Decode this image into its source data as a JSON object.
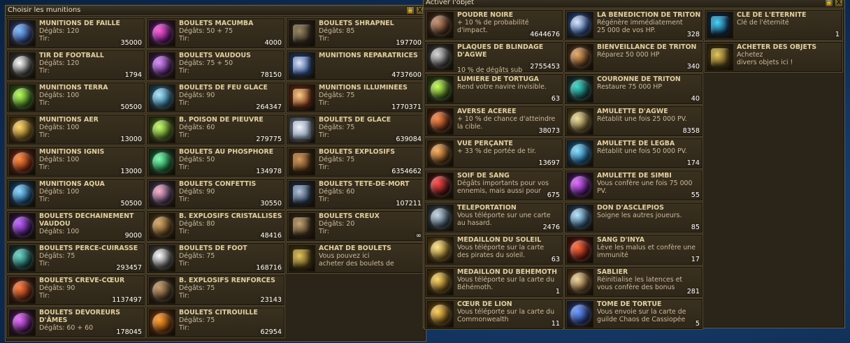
{
  "colors": {
    "accent": "#e2cfa0",
    "text": "#cdb99a",
    "panel": "#2b2418",
    "border": "#5a4c30",
    "sea": "#163a66"
  },
  "ammo_panel": {
    "title": "Choisir les munitions",
    "lock_label": "🔒",
    "close_label": "X",
    "items": [
      {
        "name": "MUNITIONS DE FAILLE",
        "l1": "Dégâts: 120",
        "l2": "Tir:",
        "count": "35000",
        "icon": "rift-ammo-icon",
        "c1": "#7ab8ff",
        "c2": "#23306a"
      },
      {
        "name": "BOULETS MACUMBA",
        "l1": "Dégâts: 50  + 75",
        "l2": "Tir:",
        "count": "4000",
        "icon": "macumba-cannonball-icon",
        "c1": "#ff5ad8",
        "c2": "#4a0a5a"
      },
      {
        "name": "BOULETS SHRAPNEL",
        "l1": "Dégâts: 85",
        "l2": "Tir:",
        "count": "197700",
        "icon": "shrapnel-cannonball-icon",
        "c1": "#9e8a66",
        "c2": "#2e261a"
      },
      {
        "name": "TIR DE FOOTBALL",
        "l1": "Dégâts: 120",
        "l2": "Tir:",
        "count": "1794",
        "icon": "football-shot-icon",
        "c1": "#ffffff",
        "c2": "#333333"
      },
      {
        "name": "BOULETS VAUDOUS",
        "l1": "Dégâts: 75  + 50",
        "l2": "Tir:",
        "count": "78150",
        "icon": "voodoo-cannonball-icon",
        "c1": "#d98cff",
        "c2": "#3a1250"
      },
      {
        "name": "MUNITIONS RÉPARATRICES",
        "l1": "",
        "l2": "",
        "count": "4737600",
        "icon": "repair-ammo-icon",
        "c1": "#dde8ff",
        "c2": "#24407a"
      },
      {
        "name": "MUNITIONS TERRA",
        "l1": "Dégâts: 100",
        "l2": "Tir:",
        "count": "50500",
        "icon": "terra-ammo-icon",
        "c1": "#b8ff5a",
        "c2": "#2a5a10"
      },
      {
        "name": "BOULETS DE FEU GLACÉ",
        "l1": "Dégâts: 90",
        "l2": "Tir:",
        "count": "264347",
        "icon": "frost-fire-cannonball-icon",
        "c1": "#a8e8ff",
        "c2": "#1a5070"
      },
      {
        "name": "MUNITIONS ILLUMINÉES",
        "l1": "Dégâts: 75",
        "l2": "Tir:",
        "count": "1770371",
        "icon": "illuminated-ammo-icon",
        "c1": "#ffd08a",
        "c2": "#6a2a10"
      },
      {
        "name": "MUNITIONS AER",
        "l1": "Dégâts: 100",
        "l2": "Tir:",
        "count": "13000",
        "icon": "aer-ammo-icon",
        "c1": "#ffd86a",
        "c2": "#6a4a10"
      },
      {
        "name": "B. POISON DE PIEUVRE",
        "l1": "Dégâts: 60",
        "l2": "Tir:",
        "count": "279775",
        "icon": "octopus-poison-icon",
        "c1": "#c8ff6a",
        "c2": "#3a5a10"
      },
      {
        "name": "BOULETS DE GLACE",
        "l1": "Dégâts: 75",
        "l2": "Tir:",
        "count": "639084",
        "icon": "ice-cannonball-icon",
        "c1": "#f2f6ff",
        "c2": "#7a8aa0"
      },
      {
        "name": "MUNITIONS IGNIS",
        "l1": "Dégâts: 100",
        "l2": "Tir:",
        "count": "13000",
        "icon": "ignis-ammo-icon",
        "c1": "#ff8a3a",
        "c2": "#6a1a08"
      },
      {
        "name": "BOULETS AU PHOSPHORE",
        "l1": "Dégâts: 50",
        "l2": "Tir:",
        "count": "134978",
        "icon": "phosphor-cannonball-icon",
        "c1": "#7affb0",
        "c2": "#0a5a2a"
      },
      {
        "name": "BOULETS EXPLOSIFS",
        "l1": "Dégâts: 75",
        "l2": "Tir:",
        "count": "6354662",
        "icon": "explosive-cannonball-icon",
        "c1": "#d8a060",
        "c2": "#4a2a10"
      },
      {
        "name": "MUNITIONS AQUA",
        "l1": "Dégâts: 100",
        "l2": "Tir:",
        "count": "50500",
        "icon": "aqua-ammo-icon",
        "c1": "#8ad8ff",
        "c2": "#0a3a6a"
      },
      {
        "name": "BOULETS CONFETTIS",
        "l1": "Dégâts: 90",
        "l2": "Tir:",
        "count": "30550",
        "icon": "confetti-cannonball-icon",
        "c1": "#ffb0d0",
        "c2": "#3a2a4a"
      },
      {
        "name": "BOULETS TÊTE-DE-MORT",
        "l1": "Dégâts: 60",
        "l2": "Tir:",
        "count": "107211",
        "icon": "skull-cannonball-icon",
        "c1": "#b8c8e0",
        "c2": "#20304a"
      },
      {
        "name": "BOULETS DÉCHAÎNEMENT VAUDOU",
        "l1": "Dégâts: 100",
        "l2": "",
        "count": "9000",
        "icon": "voodoo-frenzy-icon",
        "c1": "#c060ff",
        "c2": "#2a0a4a",
        "wrap": true
      },
      {
        "name": "B. EXPLOSIFS CRISTALLISÉS",
        "l1": "Dégâts: 80",
        "l2": "Tir:",
        "count": "48416",
        "icon": "crystal-explosive-icon",
        "c1": "#d8a868",
        "c2": "#4a3010"
      },
      {
        "name": "BOULETS CREUX",
        "l1": "Dégâts: 20",
        "l2": "Tir:",
        "count": "∞",
        "icon": "hollow-cannonball-icon",
        "c1": "#c8a878",
        "c2": "#3a2a18"
      },
      {
        "name": "BOULETS PERCE-CUIRASSE",
        "l1": "Dégâts: 75",
        "l2": "Tir:",
        "count": "293457",
        "icon": "armor-piercing-icon",
        "c1": "#6ad8c8",
        "c2": "#0a3a3a"
      },
      {
        "name": "BOULETS DE FOOT",
        "l1": "Dégâts: 75",
        "l2": "Tir:",
        "count": "168716",
        "icon": "soccer-cannonball-icon",
        "c1": "#ffffff",
        "c2": "#404040"
      },
      {
        "name": "ACHAT DE BOULETS",
        "l1": "Vous pouvez ici",
        "l2": "acheter des boulets de",
        "count": "",
        "icon": "buy-cannonballs-icon",
        "c1": "#e8c860",
        "c2": "#4a3a10"
      },
      {
        "name": "BOULETS CRÈVE-CŒUR",
        "l1": "Dégâts: 90",
        "l2": "Tir:",
        "count": "1137497",
        "icon": "heartbreaker-icon",
        "c1": "#ff7a3a",
        "c2": "#5a1a08"
      },
      {
        "name": "B. EXPLOSIFS RENFORCÉS",
        "l1": "Dégâts: 75",
        "l2": "Tir:",
        "count": "23143",
        "icon": "reinforced-explosive-icon",
        "c1": "#c89a6a",
        "c2": "#3a2a18"
      },
      {
        "name": "",
        "l1": "",
        "l2": "",
        "count": "",
        "icon": "",
        "c1": "",
        "c2": "",
        "empty": true
      },
      {
        "name": "BOULETS DÉVOREURS D'ÂMES",
        "l1": "Dégâts: 60  + 60",
        "l2": "",
        "count": "178045",
        "icon": "soul-devourer-icon",
        "c1": "#e86aff",
        "c2": "#3a0a4a",
        "wrap": true
      },
      {
        "name": "BOULETS CITROUILLE",
        "l1": "Dégâts: 75",
        "l2": "Tir:",
        "count": "62954",
        "icon": "pumpkin-cannonball-icon",
        "c1": "#ffa030",
        "c2": "#6a2a00"
      }
    ]
  },
  "items_panel": {
    "title": "Activer l'objet",
    "lock_label": "🔒",
    "close_label": "X",
    "items": [
      {
        "name": "POUDRE NOIRE",
        "l1": "+ 10 % de probabilité",
        "l2": "d'impact.",
        "count": "4644676",
        "icon": "black-powder-icon",
        "c1": "#c89070",
        "c2": "#3a2010"
      },
      {
        "name": "LA BÉNÉDICTION DE TRITON",
        "l1": "Régénère immédiatement",
        "l2": "25 000 de vos HP.",
        "count": "328",
        "icon": "triton-blessing-icon",
        "c1": "#d8e8ff",
        "c2": "#1a3a7a"
      },
      {
        "name": "CLÉ DE L'ÉTERNITÉ",
        "l1": "Clé de l'éternité",
        "l2": "",
        "count": "1",
        "icon": "eternity-key-icon",
        "c1": "#4ad8ff",
        "c2": "#0a2a4a"
      },
      {
        "name": "PLAQUES DE BLINDAGE D'AGWE",
        "l1": "",
        "l2": "10 % de dégâts sub",
        "count": "2755453",
        "icon": "agwe-armor-icon",
        "c1": "#d8d8d8",
        "c2": "#303030",
        "wrap": true
      },
      {
        "name": "BIENVEILLANCE DE TRITON",
        "l1": "Réparez 50 000 HP",
        "l2": "",
        "count": "340",
        "icon": "triton-benevolence-icon",
        "c1": "#e8a868",
        "c2": "#4a2a10"
      },
      {
        "name": "ACHETER DES OBJETS",
        "l1": "Achetez",
        "l2": "divers objets ici !",
        "count": "",
        "icon": "buy-items-icon",
        "c1": "#e8c860",
        "c2": "#4a3a10"
      },
      {
        "name": "LUMIÈRE DE TORTUGA",
        "l1": "Rend votre navire invisible.",
        "l2": "",
        "count": "63",
        "icon": "tortuga-light-icon",
        "c1": "#c8ff5a",
        "c2": "#2a4a10"
      },
      {
        "name": "COURONNE DE TRITON",
        "l1": "Restaure 75 000 HP",
        "l2": "",
        "count": "40",
        "icon": "triton-crown-icon",
        "c1": "#3ad8c8",
        "c2": "#0a3a3a"
      },
      {
        "name": "",
        "l1": "",
        "l2": "",
        "count": "",
        "icon": "",
        "c1": "",
        "c2": "",
        "empty": true
      },
      {
        "name": "AVERSE ACÉRÉE",
        "l1": "+ 10 % de chance d'atteindre",
        "l2": "la cible.",
        "count": "38073",
        "icon": "sharp-shower-icon",
        "c1": "#ff8a4a",
        "c2": "#4a1a08"
      },
      {
        "name": "AMULETTE D'AGWE",
        "l1": "Rétablit une fois 25 000 PV.",
        "l2": "",
        "count": "8358",
        "icon": "agwe-amulet-icon",
        "c1": "#f0e0a0",
        "c2": "#5a4a20"
      },
      {
        "name": "",
        "l1": "",
        "l2": "",
        "count": "",
        "icon": "",
        "c1": "",
        "c2": "",
        "empty": true
      },
      {
        "name": "VUE PERÇANTE",
        "l1": "+ 33 % de portée de tir.",
        "l2": "",
        "count": "13697",
        "icon": "keen-sight-icon",
        "c1": "#ffb060",
        "c2": "#4a2a08"
      },
      {
        "name": "AMULETTE DE LEGBA",
        "l1": "Rétablit une fois 50 000 PV.",
        "l2": "",
        "count": "174",
        "icon": "legba-amulet-icon",
        "c1": "#8ae0ff",
        "c2": "#0a4a7a"
      },
      {
        "name": "",
        "l1": "",
        "l2": "",
        "count": "",
        "icon": "",
        "c1": "",
        "c2": "",
        "empty": true
      },
      {
        "name": "SOIF DE SANG",
        "l1": "Dégâts importants pour vos",
        "l2": "ennemis, mais aussi pour",
        "count": "675",
        "icon": "bloodlust-icon",
        "c1": "#ff4a4a",
        "c2": "#3a0808"
      },
      {
        "name": "AMULETTE DE SIMBI",
        "l1": "Vous confère une fois 75 000",
        "l2": "PV.",
        "count": "55",
        "icon": "simbi-amulet-icon",
        "c1": "#e06aff",
        "c2": "#3a0a5a"
      },
      {
        "name": "",
        "l1": "",
        "l2": "",
        "count": "",
        "icon": "",
        "c1": "",
        "c2": "",
        "empty": true
      },
      {
        "name": "TÉLÉPORTATION",
        "l1": "Vous téléporte sur une carte",
        "l2": "au hasard.",
        "count": "2476",
        "icon": "teleport-icon",
        "c1": "#c8d8e8",
        "c2": "#2a3a4a"
      },
      {
        "name": "DON D'ASCLÉPIOS",
        "l1": "Soigne les autres joueurs.",
        "l2": "",
        "count": "85",
        "icon": "asclepius-gift-icon",
        "c1": "#b8e8ff",
        "c2": "#1a3a5a"
      },
      {
        "name": "",
        "l1": "",
        "l2": "",
        "count": "",
        "icon": "",
        "c1": "",
        "c2": "",
        "empty": true
      },
      {
        "name": "MÉDAILLON DU SOLEIL",
        "l1": "Vous téléporte sur la carte",
        "l2": "des pirates du soleil.",
        "count": "63",
        "icon": "sun-medallion-icon",
        "c1": "#ffe88a",
        "c2": "#6a4a10"
      },
      {
        "name": "SANG D'INYA",
        "l1": "Lève les malus et confère une",
        "l2": "immunité",
        "count": "17",
        "icon": "inya-blood-icon",
        "c1": "#ff6a3a",
        "c2": "#5a0a08"
      },
      {
        "name": "",
        "l1": "",
        "l2": "",
        "count": "",
        "icon": "",
        "c1": "",
        "c2": "",
        "empty": true
      },
      {
        "name": "MÉDAILLON DU BÉHÉMOTH",
        "l1": "Vous téléporte sur la carte du",
        "l2": "Béhémoth.",
        "count": "1",
        "icon": "behemoth-medallion-icon",
        "c1": "#ffd86a",
        "c2": "#5a3a08"
      },
      {
        "name": "SABLIER",
        "l1": "Réinitialise les latences et",
        "l2": "vous confère des bonus",
        "count": "281",
        "icon": "hourglass-icon",
        "c1": "#f0d8a0",
        "c2": "#5a3a18"
      },
      {
        "name": "",
        "l1": "",
        "l2": "",
        "count": "",
        "icon": "",
        "c1": "",
        "c2": "",
        "empty": true
      },
      {
        "name": "CŒUR DE LION",
        "l1": "Vous téléporte sur la carte du",
        "l2": "Commonwealth",
        "count": "11",
        "icon": "lionheart-icon",
        "c1": "#ffd05a",
        "c2": "#5a3a08"
      },
      {
        "name": "TOME DE TORTUE",
        "l1": "Vous envoie sur la carte de",
        "l2": "guilde Chaos de Cassiopée",
        "count": "5",
        "icon": "turtle-tome-icon",
        "c1": "#6a9aff",
        "c2": "#1a2a6a"
      }
    ]
  }
}
